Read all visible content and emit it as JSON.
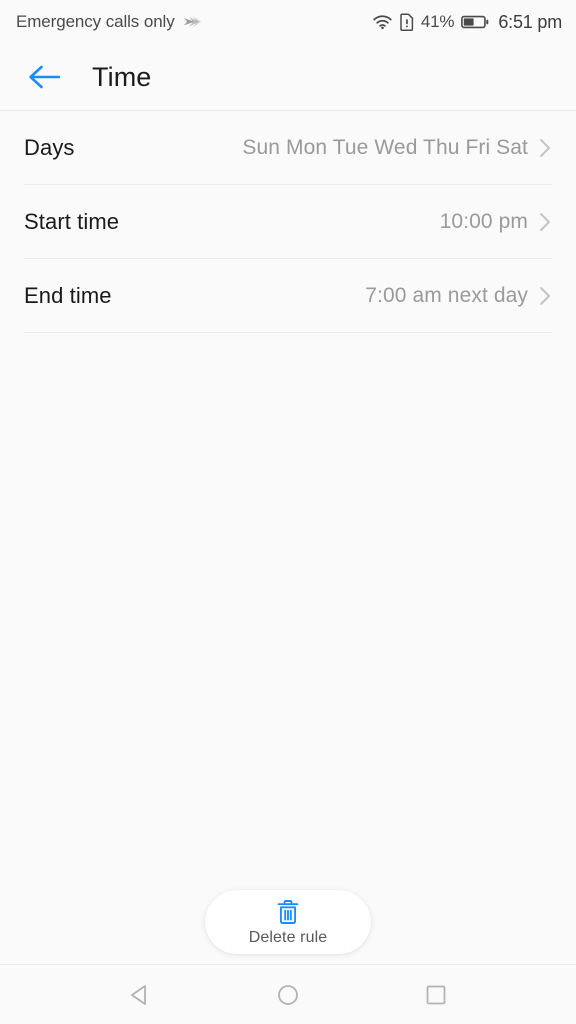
{
  "status_bar": {
    "carrier": "Emergency calls only",
    "signal_icon": "signal-bars-icon",
    "wifi_icon": "wifi-icon",
    "sim_alert_icon": "sim-card-alert-icon",
    "battery_percent": "41%",
    "battery_icon": "battery-half-icon",
    "time": "6:51 pm"
  },
  "app_bar": {
    "back_icon": "arrow-left-icon",
    "title": "Time",
    "accent_color": "#1a8cff"
  },
  "list": {
    "rows": [
      {
        "label": "Days",
        "value": "Sun Mon Tue Wed Thu Fri Sat",
        "chevron_icon": "chevron-right-icon"
      },
      {
        "label": "Start time",
        "value": "10:00 pm",
        "chevron_icon": "chevron-right-icon"
      },
      {
        "label": "End time",
        "value": "7:00 am next day",
        "chevron_icon": "chevron-right-icon"
      }
    ]
  },
  "delete_button": {
    "label": "Delete rule",
    "icon": "trash-icon",
    "icon_color": "#1a8cff"
  },
  "nav_bar": {
    "back": "nav-back-triangle-icon",
    "home": "nav-home-circle-icon",
    "recents": "nav-recents-square-icon"
  }
}
